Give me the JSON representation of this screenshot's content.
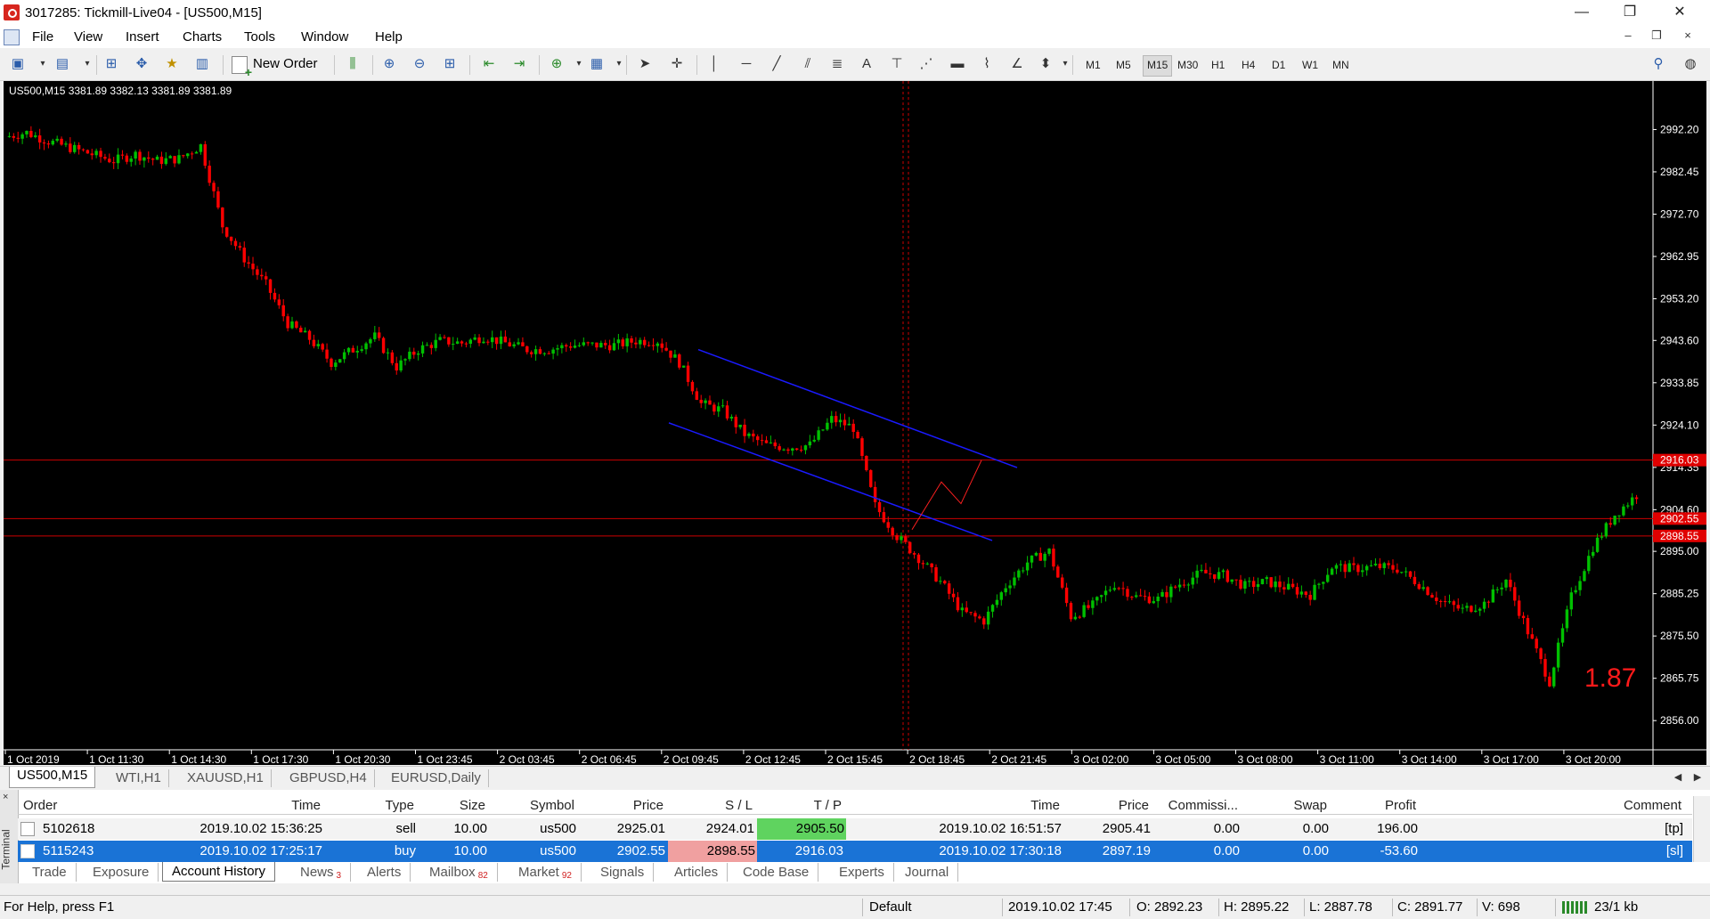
{
  "window": {
    "title": "3017285: Tickmill-Live04 - [US500,M15]",
    "minimize": "—",
    "restore": "❐",
    "close": "✕"
  },
  "menu": {
    "items": [
      "File",
      "View",
      "Insert",
      "Charts",
      "Tools",
      "Window",
      "Help"
    ],
    "mdi_minimize": "–",
    "mdi_restore": "❐",
    "mdi_close": "×"
  },
  "toolbar": {
    "new_order": "New Order",
    "text_tool": "A",
    "timeframes": [
      "M1",
      "M5",
      "M15",
      "M30",
      "H1",
      "H4",
      "D1",
      "W1",
      "MN"
    ],
    "active_timeframe": "M15"
  },
  "chart": {
    "symbol_header": "US500,M15  3381.89 3382.13 3381.89 3381.89",
    "overlay_number": "1.87",
    "colors": {
      "up": "#00c000",
      "down": "#ff0000",
      "background": "#000000",
      "grid_line": "#cc0000",
      "channel": "#1a1aff"
    }
  },
  "chart_data": {
    "type": "candlestick",
    "title": "US500,M15",
    "ylim": [
      2850.5,
      3000.5
    ],
    "y_ticks": [
      "2992.20",
      "2982.45",
      "2972.70",
      "2962.95",
      "2953.20",
      "2943.60",
      "2933.85",
      "2924.10",
      "2914.35",
      "2904.60",
      "2895.00",
      "2885.25",
      "2875.50",
      "2865.75",
      "2856.00"
    ],
    "x_ticks": [
      "1 Oct 2019",
      "1 Oct 11:30",
      "1 Oct 14:30",
      "1 Oct 17:30",
      "1 Oct 20:30",
      "1 Oct 23:45",
      "2 Oct 03:45",
      "2 Oct 06:45",
      "2 Oct 09:45",
      "2 Oct 12:45",
      "2 Oct 15:45",
      "2 Oct 18:45",
      "2 Oct 21:45",
      "3 Oct 02:00",
      "3 Oct 05:00",
      "3 Oct 08:00",
      "3 Oct 11:00",
      "3 Oct 14:00",
      "3 Oct 17:00",
      "3 Oct 20:00"
    ],
    "horizontal_lines": [
      {
        "price": 2916.03,
        "label": "2916.03"
      },
      {
        "price": 2902.55,
        "label": "2902.55"
      },
      {
        "price": 2898.55,
        "label": "2898.55"
      }
    ],
    "close_path": [
      2990.5,
      2991.5,
      2989.5,
      2988.0,
      2986.5,
      2985.0,
      2986.5,
      2985.0,
      2985.5,
      2988.5,
      2970.0,
      2962.5,
      2956.5,
      2947.5,
      2944.0,
      2938.5,
      2941.5,
      2944.5,
      2937.5,
      2941.5,
      2943.5,
      2943.0,
      2944.5,
      2943.0,
      2941.5,
      2941.5,
      2942.5,
      2942.5,
      2942.5,
      2943.5,
      2943.5,
      2938.5,
      2929.0,
      2927.5,
      2922.0,
      2919.5,
      2919.0,
      2919.5,
      2925.5,
      2923.5,
      2905.5,
      2898.5,
      2893.5,
      2888.0,
      2881.0,
      2879.0,
      2887.0,
      2892.5,
      2895.0,
      2880.0,
      2882.5,
      2887.5,
      2884.5,
      2884.0,
      2887.5,
      2890.0,
      2889.5,
      2887.0,
      2888.0,
      2886.5,
      2885.0,
      2891.5,
      2891.0,
      2891.5,
      2891.0,
      2887.5,
      2883.5,
      2881.5,
      2883.0,
      2888.5,
      2876.5,
      2865.0,
      2884.5,
      2896.0,
      2903.5,
      2908.0
    ]
  },
  "chart_tabs": [
    "US500,M15",
    "WTI,H1",
    "XAUUSD,H1",
    "GBPUSD,H4",
    "EURUSD,Daily"
  ],
  "terminal": {
    "side_label": "Terminal",
    "close_x": "×",
    "columns": [
      "Order",
      "Time",
      "Type",
      "Size",
      "Symbol",
      "Price",
      "S / L",
      "T / P",
      "Time",
      "Price",
      "Commissi...",
      "Swap",
      "Profit",
      "Comment"
    ],
    "rows": [
      {
        "order": "5102618",
        "open_time": "2019.10.02 15:36:25",
        "type": "sell",
        "size": "10.00",
        "symbol": "us500",
        "price": "2925.01",
        "sl": "2924.01",
        "tp": "2905.50",
        "close_time": "2019.10.02 16:51:57",
        "close_price": "2905.41",
        "commission": "0.00",
        "swap": "0.00",
        "profit": "196.00",
        "comment": "[tp]"
      },
      {
        "order": "5115243",
        "open_time": "2019.10.02 17:25:17",
        "type": "buy",
        "size": "10.00",
        "symbol": "us500",
        "price": "2902.55",
        "sl": "2898.55",
        "tp": "2916.03",
        "close_time": "2019.10.02 17:30:18",
        "close_price": "2897.19",
        "commission": "0.00",
        "swap": "0.00",
        "profit": "-53.60",
        "comment": "[sl]"
      }
    ],
    "tabs": [
      {
        "label": "Trade",
        "badge": ""
      },
      {
        "label": "Exposure",
        "badge": ""
      },
      {
        "label": "Account History",
        "badge": ""
      },
      {
        "label": "News",
        "badge": "3"
      },
      {
        "label": "Alerts",
        "badge": ""
      },
      {
        "label": "Mailbox",
        "badge": "82"
      },
      {
        "label": "Market",
        "badge": "92"
      },
      {
        "label": "Signals",
        "badge": ""
      },
      {
        "label": "Articles",
        "badge": ""
      },
      {
        "label": "Code Base",
        "badge": ""
      },
      {
        "label": "Experts",
        "badge": ""
      },
      {
        "label": "Journal",
        "badge": ""
      }
    ]
  },
  "status": {
    "help": "For Help, press F1",
    "profile": "Default",
    "datetime": "2019.10.02 17:45",
    "open": "O: 2892.23",
    "high": "H: 2895.22",
    "low": "L: 2887.78",
    "close": "C: 2891.77",
    "volume": "V: 698",
    "connection": "23/1 kb"
  }
}
